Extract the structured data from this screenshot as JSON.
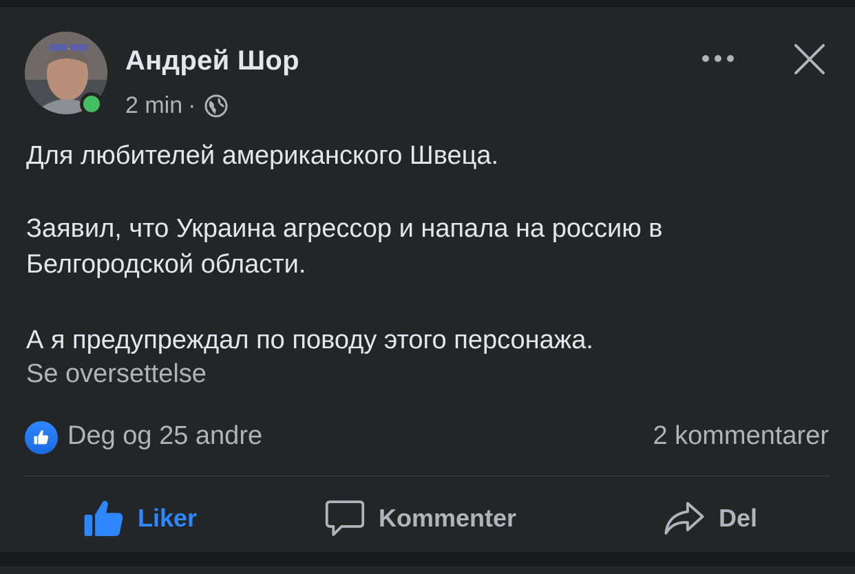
{
  "post": {
    "author": "Андрей Шор",
    "time": "2 min",
    "separator": "·",
    "privacy_icon": "globe-icon",
    "paragraphs": [
      "Для любителей американского Швеца.",
      "Заявил, что Украина агрессор и напала на россию в Белгородской области.",
      "А я предупреждал по поводу этого персонажа."
    ],
    "translate_link": "Se oversettelse"
  },
  "reactions": {
    "summary": "Deg og 25 andre",
    "comments": "2 kommentarer"
  },
  "actions": {
    "like": "Liker",
    "comment": "Kommenter",
    "share": "Del"
  },
  "colors": {
    "background": "#242526",
    "page": "#18191a",
    "text": "#e4e6eb",
    "secondary_text": "#b0b3b8",
    "accent": "#2d88ff",
    "online": "#45bd62"
  }
}
